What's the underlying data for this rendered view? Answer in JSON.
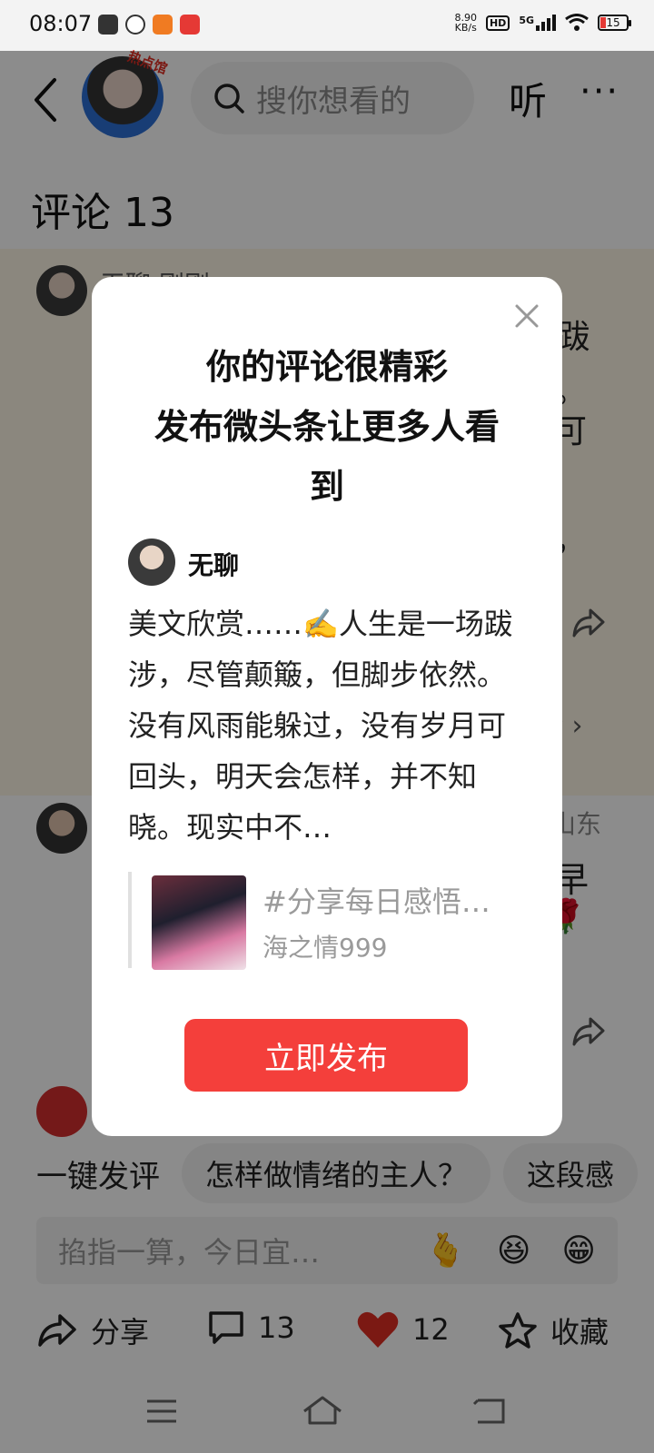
{
  "status_bar": {
    "time": "08:07",
    "net_speed_value": "8.90",
    "net_speed_unit": "KB/s",
    "hd": "HD",
    "signal": "5G",
    "battery": "15"
  },
  "header": {
    "avatar_badge": "热点馆",
    "search_placeholder": "搜你想看的",
    "listen_label": "听",
    "more_label": "···"
  },
  "comments": {
    "title": "评论 13",
    "bg_peek": {
      "author_partial": "无聊 刚刚",
      "text_a": "跋",
      "text_b": "。",
      "text_c": "可",
      "text_d": "，",
      "expand": "论 ›",
      "location": "山东",
      "text_e": "早"
    }
  },
  "reply_bar": {
    "label": "一键发评",
    "chips": [
      "怎样做情绪的主人？",
      "这段感"
    ]
  },
  "comment_input": {
    "placeholder": "掐指一算，今日宜…",
    "emojis": [
      "🫰",
      "😆",
      "😁"
    ]
  },
  "actions": {
    "share": "分享",
    "comments": "13",
    "likes": "12",
    "favorite": "收藏"
  },
  "modal": {
    "title_line1": "你的评论很精彩",
    "title_line2": "发布微头条让更多人看",
    "title_line3": "到",
    "author": "无聊",
    "body": "美文欣赏……✍️人生是一场跋涉，尽管颠簸，但脚步依然。没有风雨能躲过，没有岁月可回头，明天会怎样，并不知晓。现实中不…",
    "quote_title": "#分享每日感悟…",
    "quote_author": "海之情999",
    "publish_label": "立即发布"
  },
  "colors": {
    "accent_red": "#f43f3b",
    "heart_red": "#e02e24",
    "comment_highlight_bg": "#fdf6e6"
  }
}
